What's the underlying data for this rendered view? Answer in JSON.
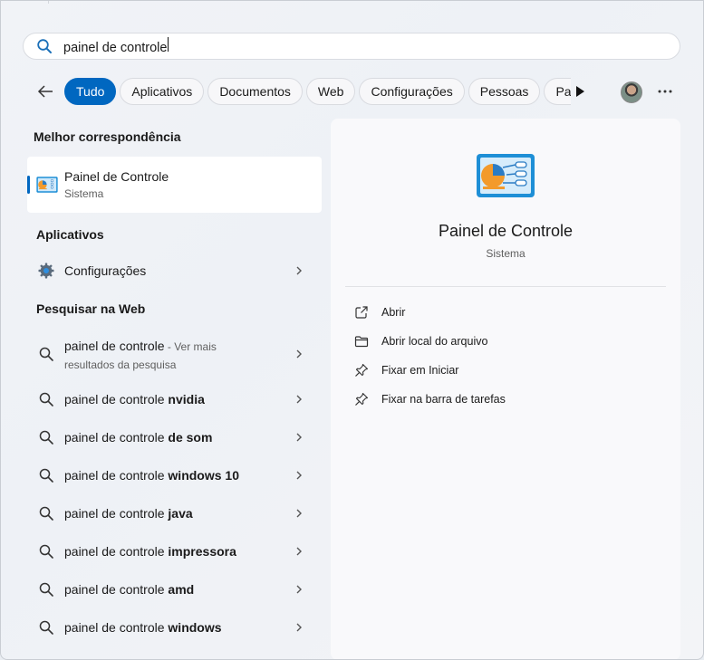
{
  "search": {
    "query": "painel de controle"
  },
  "filters": {
    "items": [
      "Tudo",
      "Aplicativos",
      "Documentos",
      "Web",
      "Configurações",
      "Pessoas",
      "Pas"
    ]
  },
  "left": {
    "best_match_title": "Melhor correspondência",
    "best_match": {
      "title": "Painel de Controle",
      "subtitle": "Sistema"
    },
    "apps_title": "Aplicativos",
    "apps": [
      {
        "label": "Configurações",
        "icon": "gear-icon"
      }
    ],
    "web_title": "Pesquisar na Web",
    "web_first": {
      "query": "painel de controle",
      "suffix_line1": " - Ver mais",
      "suffix_line2": "resultados da pesquisa"
    },
    "suggestions": [
      {
        "prefix": "painel de controle ",
        "bold": "nvidia"
      },
      {
        "prefix": "painel de controle ",
        "bold": "de som"
      },
      {
        "prefix": "painel de controle ",
        "bold": "windows 10"
      },
      {
        "prefix": "painel de controle ",
        "bold": "java"
      },
      {
        "prefix": "painel de controle ",
        "bold": "impressora"
      },
      {
        "prefix": "painel de controle ",
        "bold": "amd"
      },
      {
        "prefix": "painel de controle ",
        "bold": "windows"
      }
    ]
  },
  "detail": {
    "title": "Painel de Controle",
    "subtitle": "Sistema",
    "actions": [
      {
        "label": "Abrir",
        "icon": "open-external-icon"
      },
      {
        "label": "Abrir local do arquivo",
        "icon": "folder-icon"
      },
      {
        "label": "Fixar em Iniciar",
        "icon": "pin-icon"
      },
      {
        "label": "Fixar na barra de tarefas",
        "icon": "pin-icon"
      }
    ]
  },
  "colors": {
    "accent": "#0067c0",
    "control_panel_blue": "#1e8fd6",
    "control_panel_orange": "#f39a2b"
  }
}
